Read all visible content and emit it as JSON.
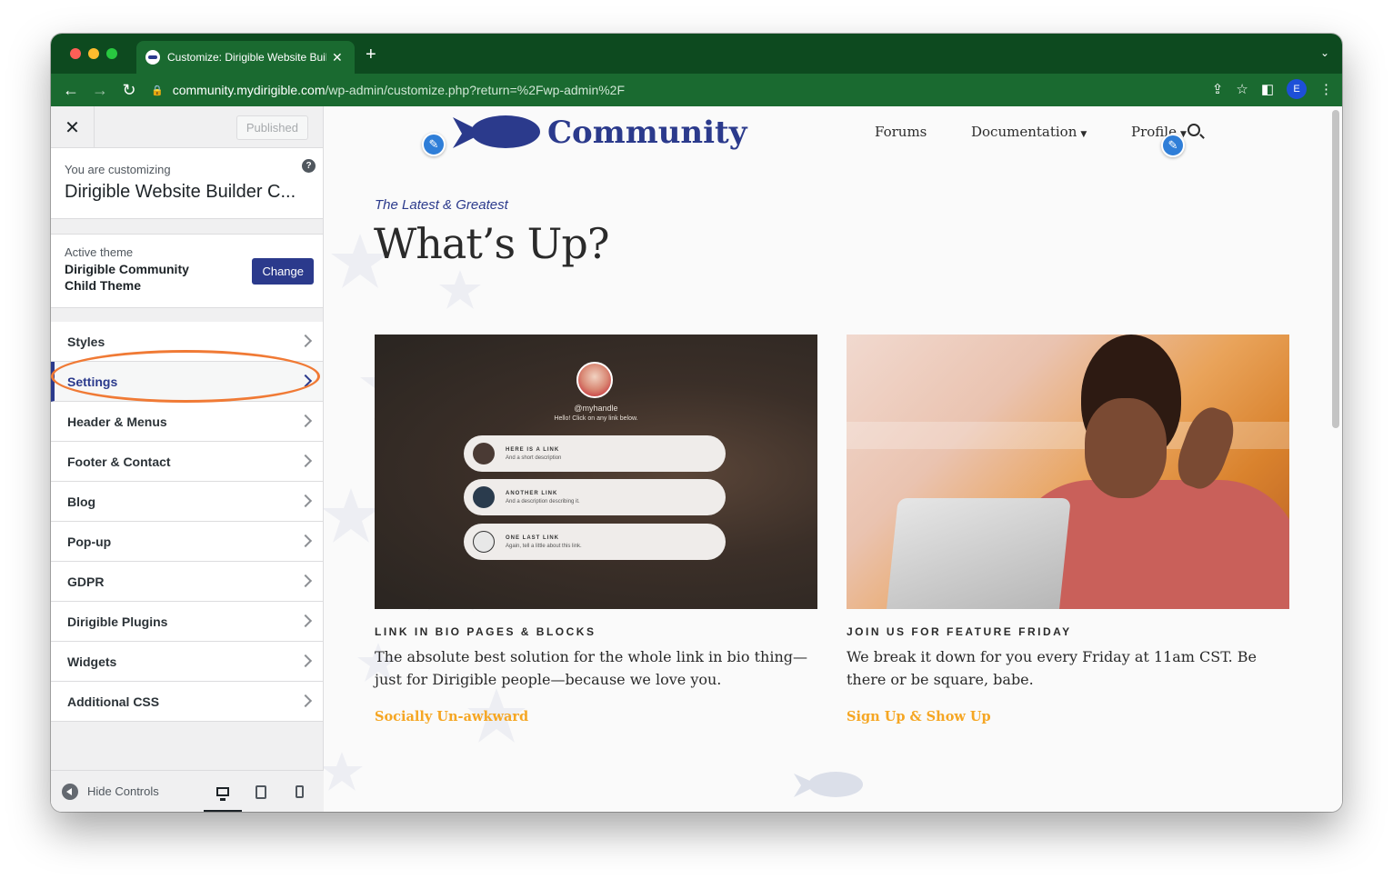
{
  "browser": {
    "tab_title": "Customize: Dirigible Website Builder Community",
    "new_tab": "+",
    "url_domain": "community.mydirigible.com",
    "url_path": "/wp-admin/customize.php?return=%2Fwp-admin%2F",
    "profile_initial": "E"
  },
  "customizer": {
    "close": "✕",
    "published_label": "Published",
    "customizing_label": "You are customizing",
    "site_title": "Dirigible Website Builder C...",
    "help": "?",
    "active_theme_label": "Active theme",
    "theme_name": "Dirigible Community Child Theme",
    "change_label": "Change",
    "panels": [
      {
        "label": "Styles"
      },
      {
        "label": "Settings"
      },
      {
        "label": "Header & Menus"
      },
      {
        "label": "Footer & Contact"
      },
      {
        "label": "Blog"
      },
      {
        "label": "Pop-up"
      },
      {
        "label": "GDPR"
      },
      {
        "label": "Dirigible Plugins"
      },
      {
        "label": "Widgets"
      },
      {
        "label": "Additional CSS"
      }
    ],
    "active_panel": "Settings",
    "hide_controls": "Hide Controls"
  },
  "preview": {
    "logo_text": "Community",
    "nav": {
      "forums": "Forums",
      "documentation": "Documentation",
      "profile": "Profile"
    },
    "kicker": "The Latest & Greatest",
    "heading": "What’s Up?",
    "cards": [
      {
        "label": "LINK IN BIO PAGES & BLOCKS",
        "text": "The absolute best solution for the whole link in bio thing—just for Dirigible people—because we love you.",
        "link": "Socially Un-awkward",
        "mockup": {
          "handle": "@myhandle",
          "hello": "Hello! Click on any link below.",
          "links": [
            {
              "title": "HERE IS A LINK",
              "desc": "And a short description"
            },
            {
              "title": "ANOTHER LINK",
              "desc": "And a description describing it."
            },
            {
              "title": "ONE LAST LINK",
              "desc": "Again, tell a little about this link."
            }
          ]
        }
      },
      {
        "label": "JOIN US FOR FEATURE FRIDAY",
        "text": "We break it down for you every Friday at 11am CST. Be there or be square, babe.",
        "link": "Sign Up & Show Up"
      }
    ],
    "colors": {
      "brand": "#2b3a8c",
      "link": "#f5a623"
    }
  }
}
